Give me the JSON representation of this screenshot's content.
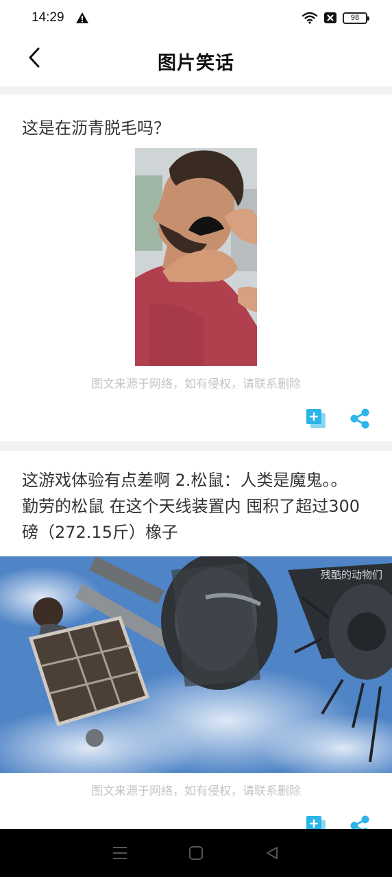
{
  "status_bar": {
    "time": "14:29",
    "battery": "98",
    "icons": [
      "warning-icon",
      "wifi-icon",
      "sim-blocked-icon",
      "battery-icon"
    ]
  },
  "header": {
    "title": "图片笑话",
    "back_icon": "chevron-left-icon"
  },
  "feed": {
    "items": [
      {
        "text": "这是在沥青脱毛吗？",
        "disclaimer": "图文来源于网络，如有侵权，请联系删除",
        "actions": [
          "copy-icon",
          "share-icon"
        ]
      },
      {
        "text": "这游戏体验有点差啊 2.松鼠：人类是魔鬼。。 勤劳的松鼠 在这个天线装置内 囤积了超过300磅（272.15斤）橡子",
        "watermark": "残酷的动物们",
        "disclaimer": "图文来源于网络，如有侵权，请联系删除",
        "actions": [
          "copy-icon",
          "share-icon"
        ]
      }
    ]
  },
  "colors": {
    "accent": "#2bb5e8",
    "background": "#f2f2f2",
    "card": "#ffffff",
    "disclaimer": "#c4c4c4"
  },
  "nav_bar": {
    "buttons": [
      "menu-icon",
      "home-icon",
      "back-triangle-icon"
    ]
  }
}
